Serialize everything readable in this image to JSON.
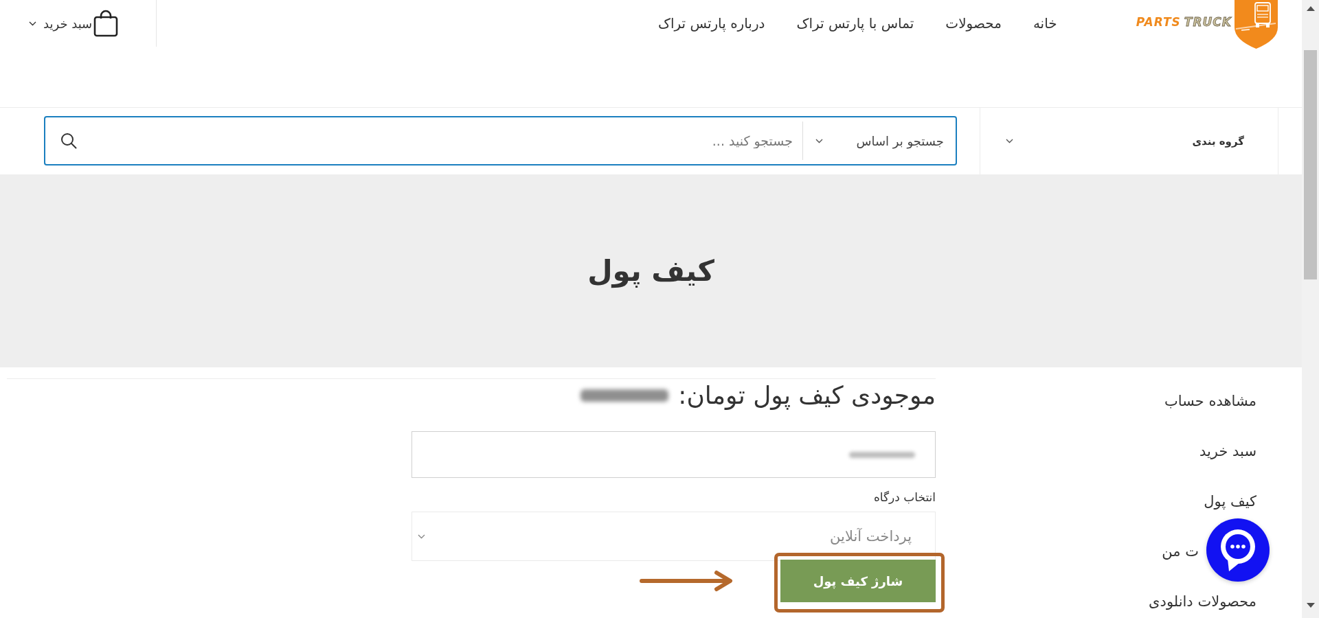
{
  "header": {
    "logo": {
      "words": [
        {
          "text": "TRUCK",
          "kind": "outlined"
        },
        {
          "text": "PARTS",
          "kind": "filled"
        }
      ]
    },
    "nav": [
      "خانه",
      "محصولات",
      "تماس با پارتس تراک",
      "درباره پارتس تراک"
    ],
    "cart": {
      "label": "سبد خرید"
    }
  },
  "search_bar": {
    "category": {
      "label": "گروه بندی"
    },
    "search_by": {
      "label": "جستجو بر اساس"
    },
    "search": {
      "placeholder": "جستجو کنید ..."
    }
  },
  "page_title": "کیف پول",
  "sidebar": {
    "items": [
      {
        "label": "مشاهده حساب",
        "kind": "link"
      },
      {
        "label": "سبد خرید",
        "kind": "link"
      },
      {
        "label": "کیف پول",
        "kind": "link"
      },
      {
        "label": "ت من",
        "kind": "covered"
      },
      {
        "label": "محصولات دانلودی",
        "kind": "link"
      }
    ]
  },
  "wallet": {
    "balance_label": "موجودی کیف پول تومان:",
    "gateway_label": "انتخاب درگاه",
    "gateway": {
      "value": "پرداخت آنلاین"
    },
    "submit": "شارژ کیف پول"
  }
}
